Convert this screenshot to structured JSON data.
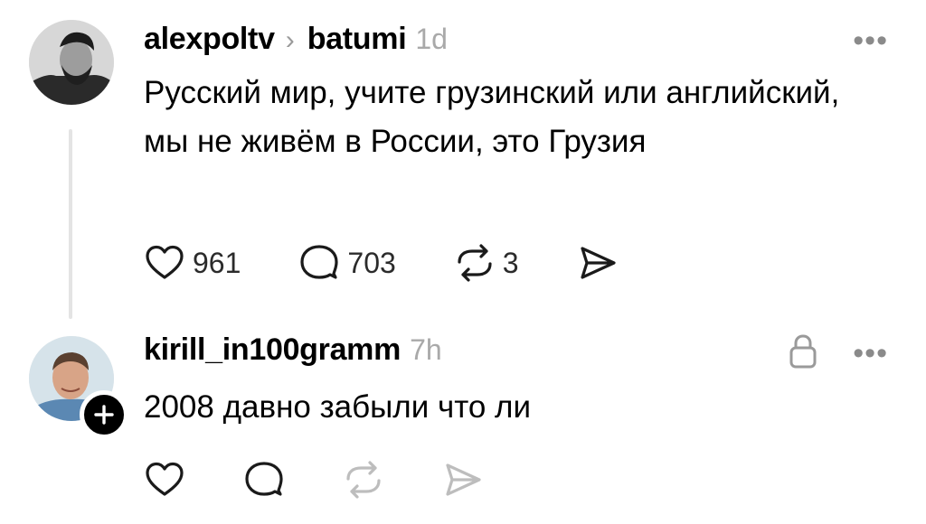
{
  "post1": {
    "username": "alexpoltv",
    "separator": "›",
    "community": "batumi",
    "time": "1d",
    "more": "•••",
    "text": "Русский мир, учите грузинский или английский, мы не живём в России, это Грузия",
    "likes": "961",
    "comments": "703",
    "reposts": "3"
  },
  "post2": {
    "username": "kirill_in100gramm",
    "time": "7h",
    "more": "•••",
    "text": "2008 давно забыли что ли"
  },
  "icons": {
    "like": "heart-icon",
    "comment": "comment-icon",
    "repost": "repost-icon",
    "share": "send-icon",
    "lock": "lock-icon",
    "follow": "plus-icon"
  },
  "colors": {
    "text": "#000000",
    "muted": "#a9a9a9",
    "icon_active": "#1a1a1a",
    "icon_disabled": "#bdbdbd",
    "thread_line": "#e4e4e4"
  }
}
